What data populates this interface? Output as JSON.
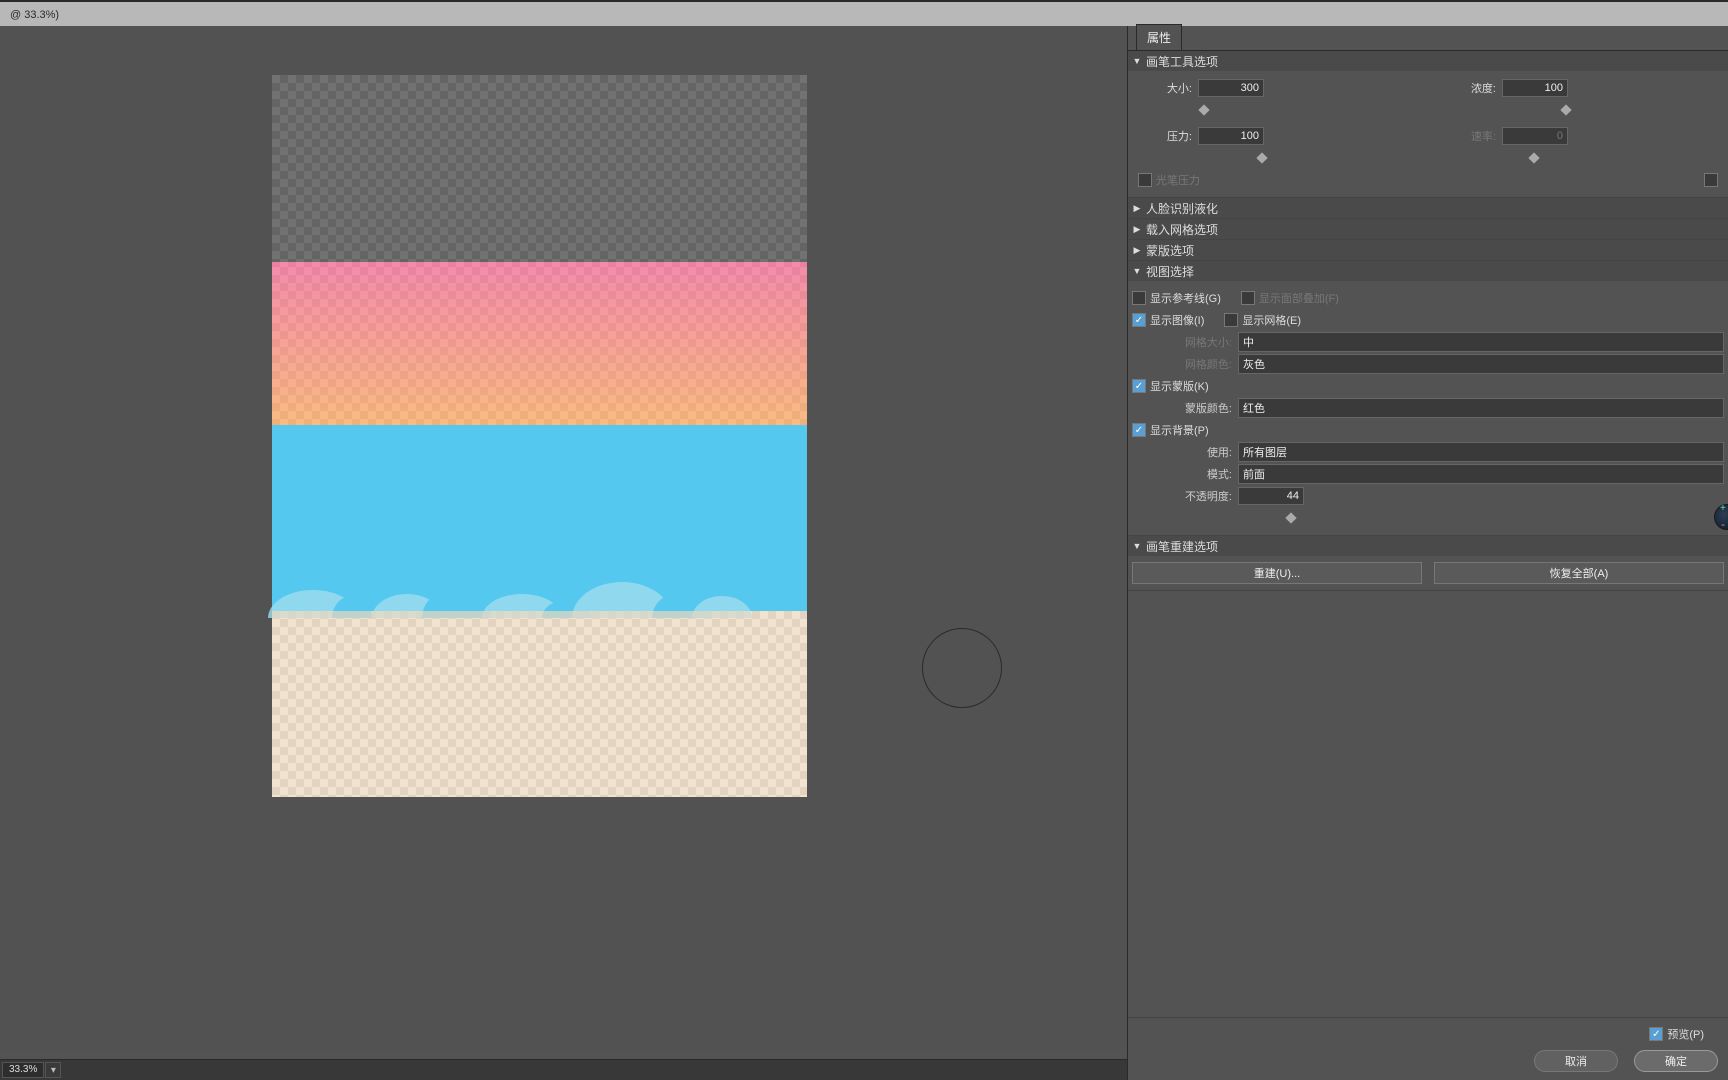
{
  "tab": {
    "title": "@ 33.3%)"
  },
  "zoom": {
    "value": "33.3%"
  },
  "panel": {
    "title": "属性",
    "brush_tool": {
      "title": "画笔工具选项",
      "size_label": "大小:",
      "size": "300",
      "density_label": "浓度:",
      "density": "100",
      "pressure_label": "压力:",
      "pressure": "100",
      "rate_label": "速率:",
      "rate": "0",
      "pen_pressure": "光笔压力"
    },
    "face_detect": {
      "title": "人脸识别液化"
    },
    "load_mesh": {
      "title": "载入网格选项"
    },
    "mask_opts": {
      "title": "蒙版选项"
    },
    "view_opts": {
      "title": "视图选择",
      "show_guides": "显示参考线(G)",
      "show_face_overlay": "显示面部叠加(F)",
      "show_image": "显示图像(I)",
      "show_mesh": "显示网格(E)",
      "mesh_size_label": "网格大小:",
      "mesh_size": "中",
      "mesh_color_label": "网格颜色:",
      "mesh_color": "灰色",
      "show_mask": "显示蒙版(K)",
      "mask_color_label": "蒙版颜色:",
      "mask_color": "红色",
      "show_bg": "显示背景(P)",
      "use_label": "使用:",
      "use": "所有图层",
      "mode_label": "模式:",
      "mode": "前面",
      "opacity_label": "不透明度:",
      "opacity": "44"
    },
    "reconstruct": {
      "title": "画笔重建选项",
      "rebuild": "重建(U)...",
      "restore_all": "恢复全部(A)"
    },
    "footer": {
      "preview": "预览(P)",
      "cancel": "取消",
      "ok": "确定"
    }
  }
}
